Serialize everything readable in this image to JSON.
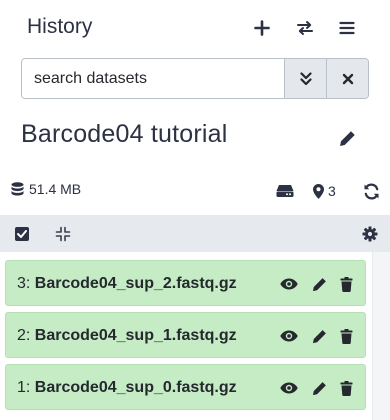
{
  "header": {
    "title": "History"
  },
  "search": {
    "placeholder": "search datasets"
  },
  "history": {
    "name": "Barcode04 tutorial",
    "size": "51.4 MB",
    "tag_count": "3"
  },
  "datasets": [
    {
      "hid": "3:",
      "name": "Barcode04_sup_2.fastq.gz"
    },
    {
      "hid": "2:",
      "name": "Barcode04_sup_1.fastq.gz"
    },
    {
      "hid": "1:",
      "name": "Barcode04_sup_0.fastq.gz"
    }
  ],
  "colors": {
    "dataset_ok_bg": "#c5ecc5",
    "toolbar_bg": "#e6e9ee",
    "text_dark": "#2c3143"
  }
}
